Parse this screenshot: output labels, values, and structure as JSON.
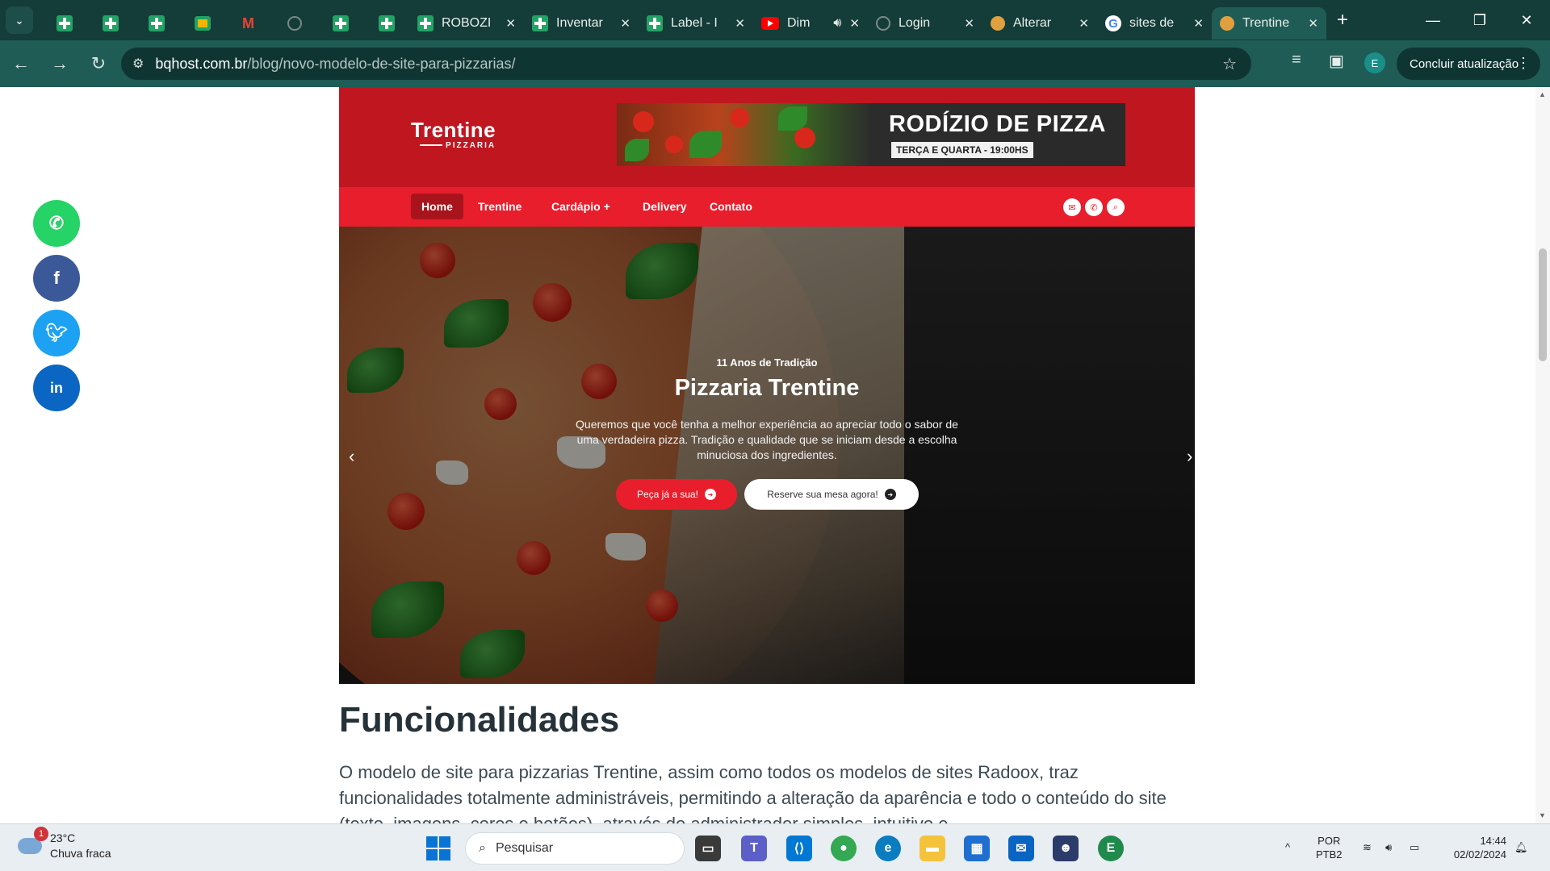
{
  "browser": {
    "tabs": [
      {
        "title": "",
        "icon": "sheets-icon"
      },
      {
        "title": "",
        "icon": "sheets-icon"
      },
      {
        "title": "",
        "icon": "sheets-icon"
      },
      {
        "title": "",
        "icon": "google-chat-icon"
      },
      {
        "title": "",
        "icon": "gmail-icon"
      },
      {
        "title": "",
        "icon": "globe-icon"
      },
      {
        "title": "",
        "icon": "sheets-icon"
      },
      {
        "title": "",
        "icon": "sheets-icon"
      },
      {
        "title": "ROBOZI",
        "icon": "sheets-icon"
      },
      {
        "title": "Inventar",
        "icon": "sheets-icon"
      },
      {
        "title": "Label - I",
        "icon": "sheets-icon"
      },
      {
        "title": "Dim",
        "icon": "youtube-icon"
      },
      {
        "title": "Login",
        "icon": "globe-icon"
      },
      {
        "title": "Alterar",
        "icon": "pizza-icon"
      },
      {
        "title": "sites de",
        "icon": "google-icon"
      },
      {
        "title": "Trentine",
        "icon": "pizza-icon",
        "active": true
      }
    ],
    "url_host": "bqhost.com.br",
    "url_path": "/blog/novo-modelo-de-site-para-pizzarias/",
    "profile_initial": "E",
    "update_label": "Concluir atualização"
  },
  "share": [
    {
      "name": "whatsapp",
      "icon": "whatsapp-icon",
      "color": "#25d366"
    },
    {
      "name": "facebook",
      "icon": "facebook-icon",
      "color": "#3b5998"
    },
    {
      "name": "twitter",
      "icon": "twitter-icon",
      "color": "#1da1f2"
    },
    {
      "name": "linkedin",
      "icon": "linkedin-icon",
      "color": "#0a66c2"
    }
  ],
  "site": {
    "logo_name": "Trentine",
    "logo_sub": "PIZZARIA",
    "banner_title": "RODÍZIO DE PIZZA",
    "banner_sub": "TERÇA E QUARTA - 19:00HS",
    "nav": {
      "home": "Home",
      "trentine": "Trentine",
      "cardapio": "Cardápio",
      "cardapio_plus": "+",
      "delivery": "Delivery",
      "contato": "Contato"
    },
    "hero": {
      "kicker": "11 Anos de Tradição",
      "title": "Pizzaria Trentine",
      "text": "Queremos que você tenha a melhor experiência ao apreciar todo o sabor de uma verdadeira pizza. Tradição e qualidade que se iniciam desde a escolha minuciosa dos ingredientes.",
      "btn_order": "Peça já a sua!",
      "btn_reserve": "Reserve sua mesa agora!"
    },
    "colors": {
      "header_red": "#bf1620",
      "nav_red": "#e81e2c"
    }
  },
  "article": {
    "heading": "Funcionalidades",
    "paragraph": "O modelo de site para pizzarias Trentine, assim como todos os modelos de sites Radoox, traz funcionalidades totalmente administráveis, permitindo a alteração da aparência e todo o conteúdo do site (texto, imagens, cores e botões), através do administrador simples, intuitivo e"
  },
  "taskbar": {
    "weather_badge": "1",
    "temperature": "23°C",
    "weather_desc": "Chuva fraca",
    "search_placeholder": "Pesquisar",
    "lang_1": "POR",
    "lang_2": "PTB2",
    "time": "14:44",
    "date": "02/02/2024"
  }
}
